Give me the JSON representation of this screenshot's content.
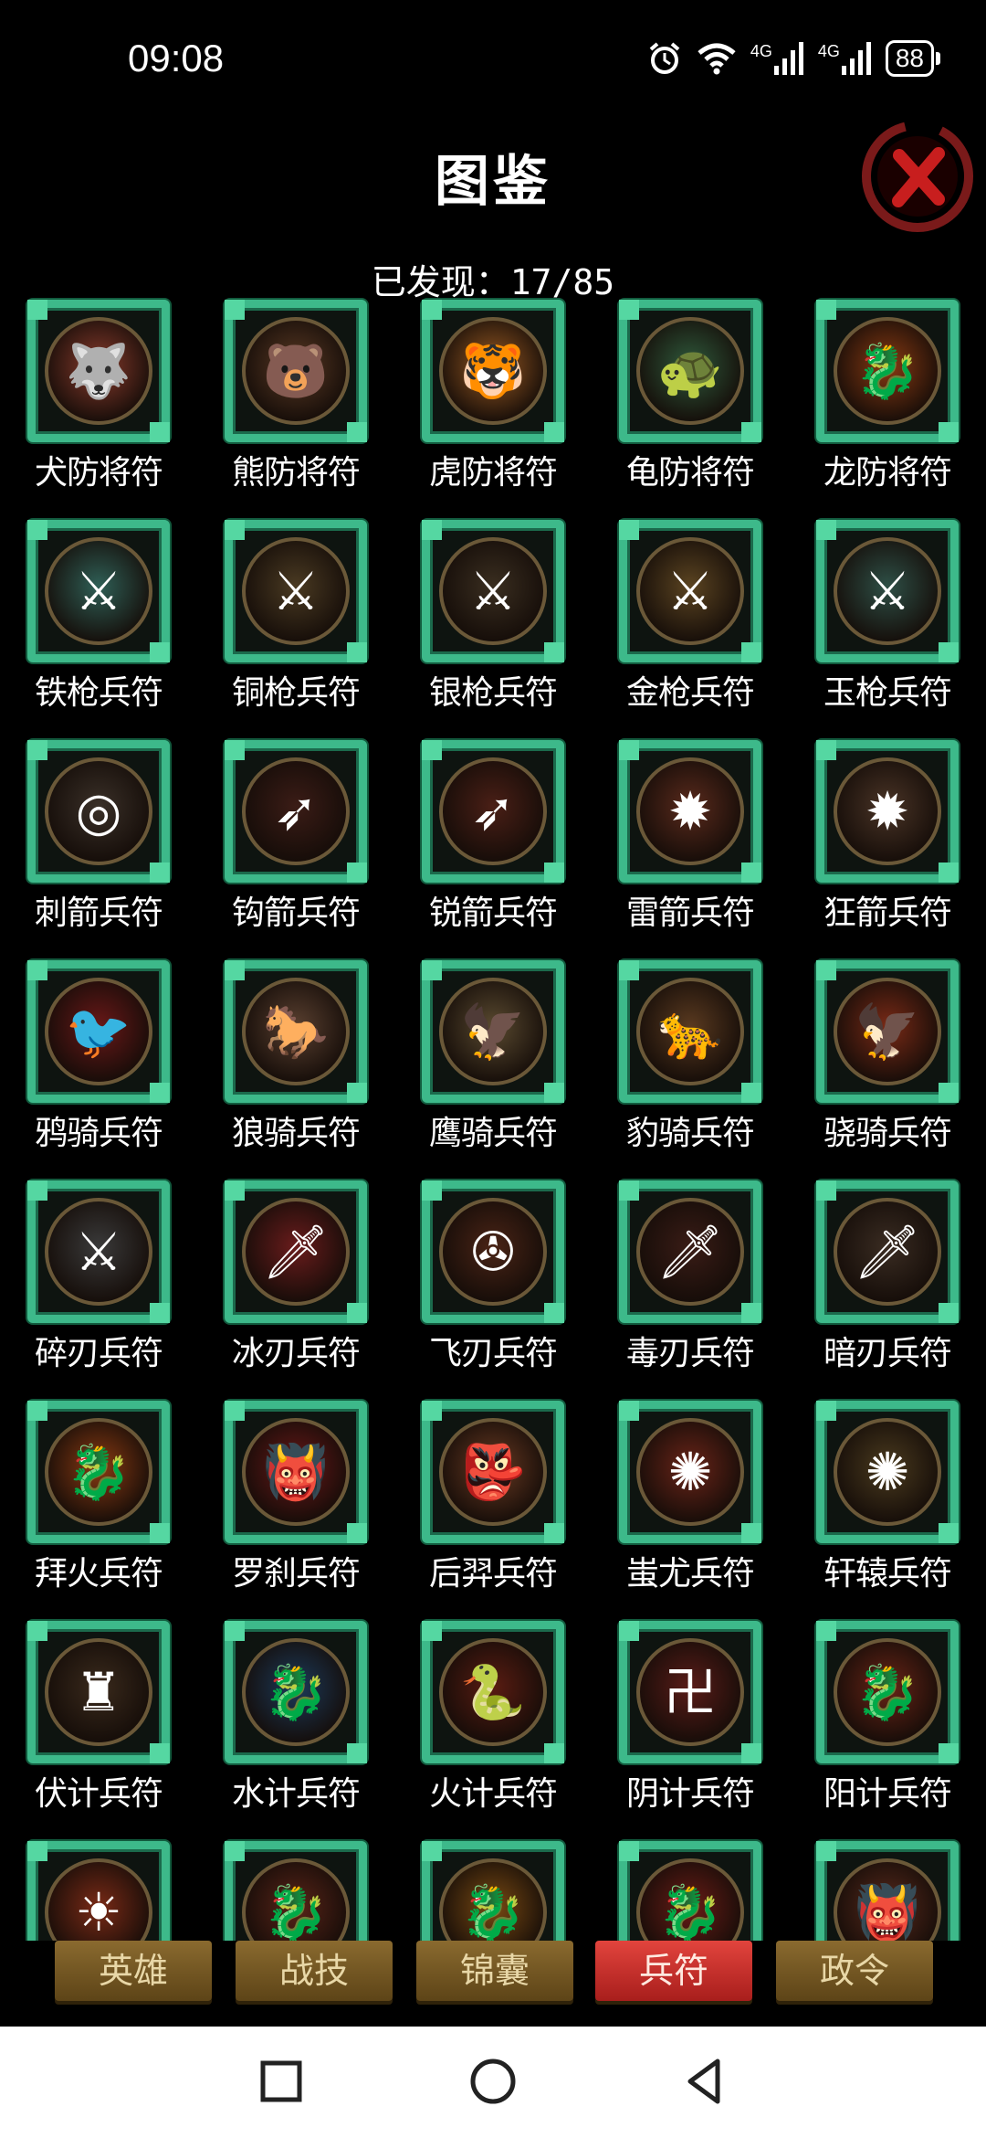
{
  "status_bar": {
    "time": "09:08",
    "signal_1": "4G",
    "signal_2": "4G",
    "battery": "88"
  },
  "header": {
    "title": "图鉴",
    "found_label": "已发现：17/85"
  },
  "cards": [
    {
      "label": "犬防将符",
      "icon": "wolf-emblem",
      "color": "#8a3b2c",
      "glyph": "🐺"
    },
    {
      "label": "熊防将符",
      "icon": "bear-emblem",
      "color": "#5b3a24",
      "glyph": "🐻"
    },
    {
      "label": "虎防将符",
      "icon": "tiger-emblem",
      "color": "#9a5a22",
      "glyph": "🐯"
    },
    {
      "label": "龟防将符",
      "icon": "turtle-emblem",
      "color": "#2f5a3c",
      "glyph": "🐢"
    },
    {
      "label": "龙防将符",
      "icon": "dragon-emblem",
      "color": "#8a3a12",
      "glyph": "🐉"
    },
    {
      "label": "铁枪兵符",
      "icon": "iron-spear-emblem",
      "color": "#2f5f56",
      "glyph": "⚔"
    },
    {
      "label": "铜枪兵符",
      "icon": "copper-spear-emblem",
      "color": "#4a3a22",
      "glyph": "⚔"
    },
    {
      "label": "银枪兵符",
      "icon": "silver-spear-emblem",
      "color": "#3a2e20",
      "glyph": "⚔"
    },
    {
      "label": "金枪兵符",
      "icon": "gold-spear-emblem",
      "color": "#5b4421",
      "glyph": "⚔"
    },
    {
      "label": "玉枪兵符",
      "icon": "jade-spear-emblem",
      "color": "#2e4f46",
      "glyph": "⚔"
    },
    {
      "label": "刺箭兵符",
      "icon": "thorn-arrow-emblem",
      "color": "#3a3028",
      "glyph": "◎"
    },
    {
      "label": "钩箭兵符",
      "icon": "hook-arrow-emblem",
      "color": "#3b1c16",
      "glyph": "➶"
    },
    {
      "label": "锐箭兵符",
      "icon": "sharp-arrow-emblem",
      "color": "#4a1f16",
      "glyph": "➶"
    },
    {
      "label": "雷箭兵符",
      "icon": "thunder-arrow-emblem",
      "color": "#5a2a1c",
      "glyph": "✹"
    },
    {
      "label": "狂箭兵符",
      "icon": "frenzy-arrow-emblem",
      "color": "#4a3426",
      "glyph": "✹"
    },
    {
      "label": "鸦骑兵符",
      "icon": "crow-rider-emblem",
      "color": "#6a1818",
      "glyph": "🐦"
    },
    {
      "label": "狼骑兵符",
      "icon": "wolf-rider-emblem",
      "color": "#5a4030",
      "glyph": "🐎"
    },
    {
      "label": "鹰骑兵符",
      "icon": "eagle-rider-emblem",
      "color": "#5a4a30",
      "glyph": "🦅"
    },
    {
      "label": "豹骑兵符",
      "icon": "leopard-rider-emblem",
      "color": "#5a3a20",
      "glyph": "🐆"
    },
    {
      "label": "骁骑兵符",
      "icon": "brave-rider-emblem",
      "color": "#7a2a16",
      "glyph": "🦅"
    },
    {
      "label": "碎刃兵符",
      "icon": "broken-blade-emblem",
      "color": "#3a3a3a",
      "glyph": "⚔"
    },
    {
      "label": "冰刃兵符",
      "icon": "ice-blade-emblem",
      "color": "#6a1c1c",
      "glyph": "🗡"
    },
    {
      "label": "飞刃兵符",
      "icon": "flying-blade-emblem",
      "color": "#4a2416",
      "glyph": "✇"
    },
    {
      "label": "毒刃兵符",
      "icon": "poison-blade-emblem",
      "color": "#3a1c16",
      "glyph": "🗡"
    },
    {
      "label": "暗刃兵符",
      "icon": "shadow-blade-emblem",
      "color": "#3a2c22",
      "glyph": "🗡"
    },
    {
      "label": "拜火兵符",
      "icon": "fire-dragon-emblem",
      "color": "#8a3a12",
      "glyph": "🐉"
    },
    {
      "label": "罗刹兵符",
      "icon": "rakshasa-emblem",
      "color": "#6a1818",
      "glyph": "👹"
    },
    {
      "label": "后羿兵符",
      "icon": "houyi-emblem",
      "color": "#6a3a22",
      "glyph": "👺"
    },
    {
      "label": "蚩尤兵符",
      "icon": "chiyou-emblem",
      "color": "#6a2418",
      "glyph": "✺"
    },
    {
      "label": "轩辕兵符",
      "icon": "xuanyuan-emblem",
      "color": "#4a3a1e",
      "glyph": "✺"
    },
    {
      "label": "伏计兵符",
      "icon": "ambush-emblem",
      "color": "#3a2a1c",
      "glyph": "♜"
    },
    {
      "label": "水计兵符",
      "icon": "water-dragon-emblem",
      "color": "#1c3a5a",
      "glyph": "🐉"
    },
    {
      "label": "火计兵符",
      "icon": "fire-serpent-emblem",
      "color": "#5a1c12",
      "glyph": "🐍"
    },
    {
      "label": "阴计兵符",
      "icon": "yin-emblem",
      "color": "#5a1c18",
      "glyph": "卍"
    },
    {
      "label": "阳计兵符",
      "icon": "yang-dragon-emblem",
      "color": "#6a2416",
      "glyph": "🐉"
    },
    {
      "label": "",
      "icon": "red-sun-emblem",
      "color": "#7a2a16",
      "glyph": "☀"
    },
    {
      "label": "",
      "icon": "serpent-emblem",
      "color": "#5a2418",
      "glyph": "🐉"
    },
    {
      "label": "",
      "icon": "golden-dragon-emblem",
      "color": "#7a4a12",
      "glyph": "🐉"
    },
    {
      "label": "",
      "icon": "red-dragon-emblem",
      "color": "#6a1c16",
      "glyph": "🐉"
    },
    {
      "label": "",
      "icon": "beast-emblem",
      "color": "#5a2a1c",
      "glyph": "👹"
    }
  ],
  "tabs": [
    {
      "label": "英雄",
      "active": false
    },
    {
      "label": "战技",
      "active": false
    },
    {
      "label": "锦囊",
      "active": false
    },
    {
      "label": "兵符",
      "active": true
    },
    {
      "label": "政令",
      "active": false
    }
  ],
  "colors": {
    "frame": "#3db98a",
    "tab_active": "#e2443d",
    "tab_inactive": "#8a6a2f"
  }
}
